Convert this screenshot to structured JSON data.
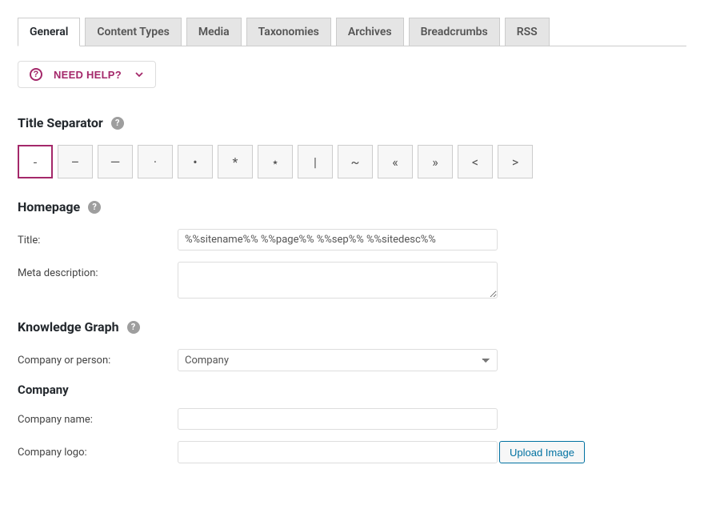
{
  "tabs": [
    {
      "label": "General",
      "active": true
    },
    {
      "label": "Content Types",
      "active": false
    },
    {
      "label": "Media",
      "active": false
    },
    {
      "label": "Taxonomies",
      "active": false
    },
    {
      "label": "Archives",
      "active": false
    },
    {
      "label": "Breadcrumbs",
      "active": false
    },
    {
      "label": "RSS",
      "active": false
    }
  ],
  "help": {
    "label": "NEED HELP?"
  },
  "sections": {
    "titleSeparator": {
      "heading": "Title Separator",
      "options": [
        "-",
        "–",
        "—",
        "·",
        "•",
        "*",
        "⋆",
        "|",
        "~",
        "«",
        "»",
        "<",
        ">"
      ],
      "selectedIndex": 0
    },
    "homepage": {
      "heading": "Homepage",
      "titleLabel": "Title:",
      "titleValue": "%%sitename%% %%page%% %%sep%% %%sitedesc%%",
      "metaLabel": "Meta description:",
      "metaValue": ""
    },
    "knowledgeGraph": {
      "heading": "Knowledge Graph",
      "companyOrPersonLabel": "Company or person:",
      "companyOrPersonValue": "Company",
      "subHeading": "Company",
      "companyNameLabel": "Company name:",
      "companyNameValue": "",
      "companyLogoLabel": "Company logo:",
      "companyLogoValue": "",
      "uploadLabel": "Upload Image"
    }
  }
}
